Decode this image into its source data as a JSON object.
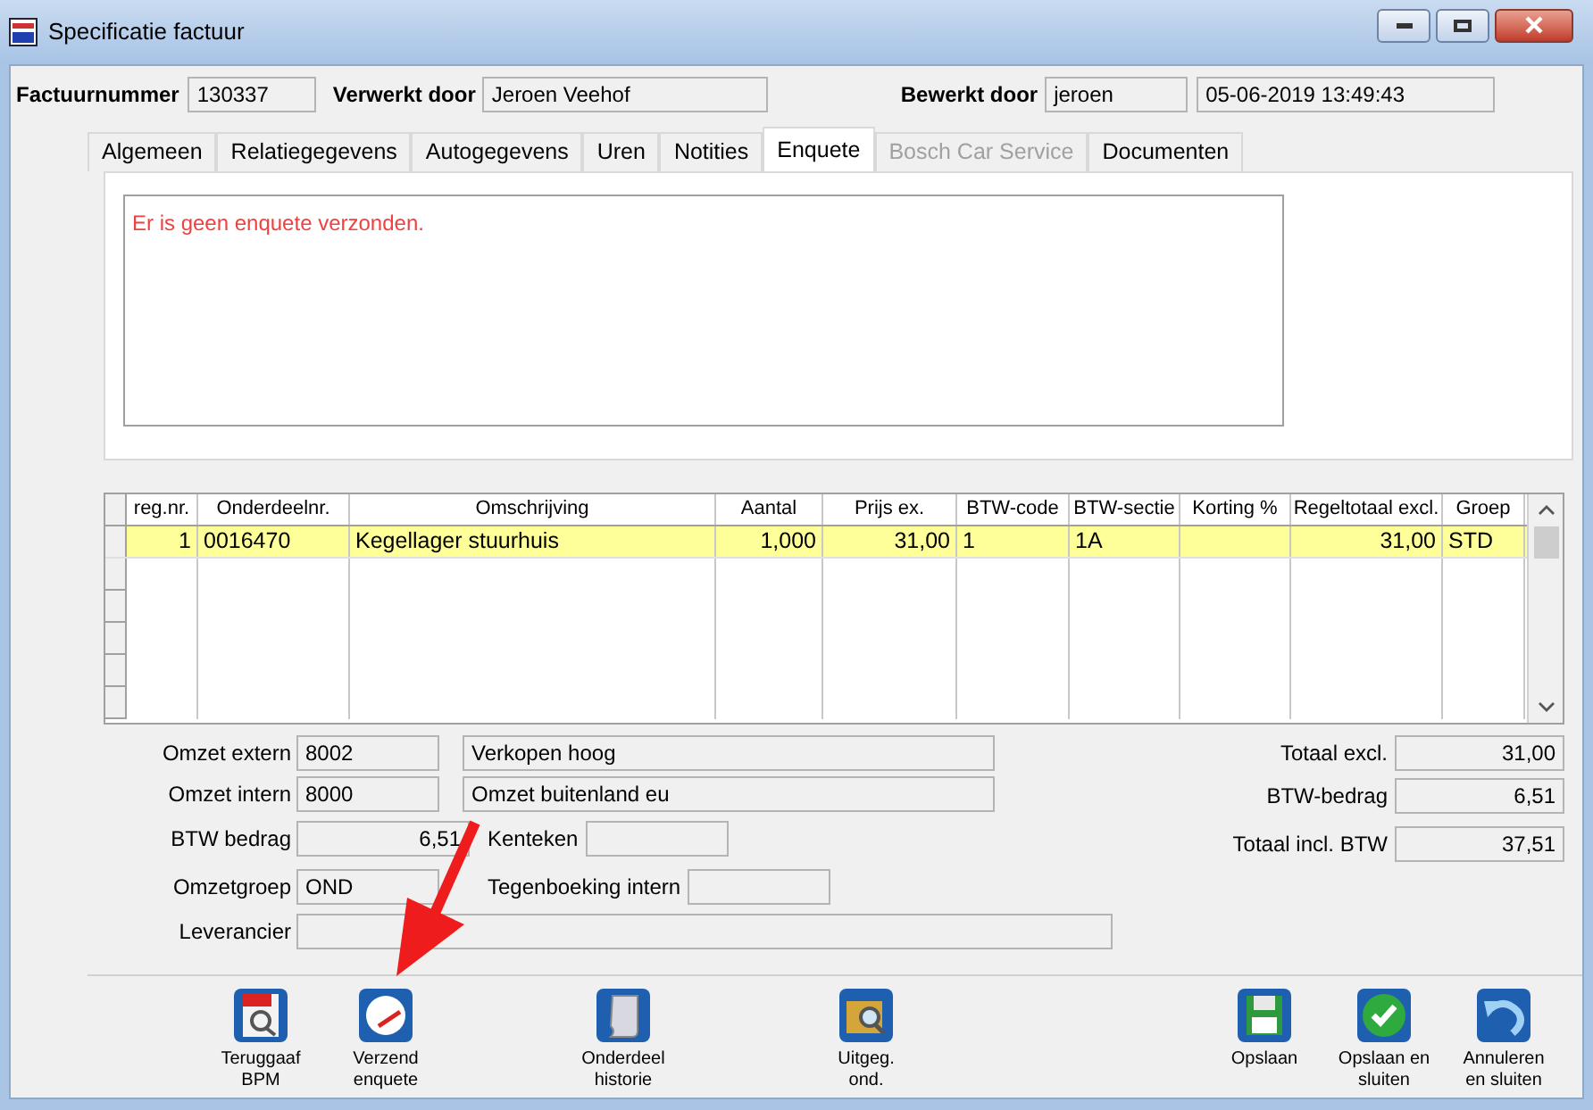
{
  "window": {
    "title": "Specificatie factuur"
  },
  "header": [
    {
      "label": "Factuurnummer",
      "value": "130337"
    },
    {
      "label": "Verwerkt door",
      "value": "Jeroen Veehof"
    },
    {
      "label": "Bewerkt door",
      "value": "jeroen"
    },
    {
      "value": "05-06-2019 13:49:43"
    }
  ],
  "tabs": [
    {
      "label": "Algemeen",
      "selected": false,
      "disabled": false
    },
    {
      "label": "Relatiegegevens",
      "selected": false,
      "disabled": false
    },
    {
      "label": "Autogegevens",
      "selected": false,
      "disabled": false
    },
    {
      "label": "Uren",
      "selected": false,
      "disabled": false
    },
    {
      "label": "Notities",
      "selected": false,
      "disabled": false
    },
    {
      "label": "Enquete",
      "selected": true,
      "disabled": false
    },
    {
      "label": "Bosch Car Service",
      "selected": false,
      "disabled": true
    },
    {
      "label": "Documenten",
      "selected": false,
      "disabled": false
    }
  ],
  "enquete": {
    "message": "Er is geen enquete verzonden."
  },
  "table": {
    "columns": [
      "reg.nr.",
      "Onderdeelnr.",
      "Omschrijving",
      "Aantal",
      "Prijs ex.",
      "BTW-code",
      "BTW-sectie",
      "Korting %",
      "Regeltotaal excl.",
      "Groep"
    ],
    "rows": [
      {
        "selected": true,
        "cells": [
          "1",
          "0016470",
          "Kegellager stuurhuis",
          "1,000",
          "31,00",
          "1",
          "1A",
          "",
          "31,00",
          "STD"
        ]
      }
    ]
  },
  "form": {
    "omzet_extern": {
      "label": "Omzet extern",
      "code": "8002",
      "description": "Verkopen hoog"
    },
    "omzet_intern": {
      "label": "Omzet intern",
      "code": "8000",
      "description": "Omzet buitenland eu"
    },
    "btw_bedrag": {
      "label": "BTW bedrag",
      "value": "6,51"
    },
    "kenteken": {
      "label": "Kenteken"
    },
    "omzetgroep": {
      "label": "Omzetgroep",
      "value": "OND"
    },
    "tegenboeking": {
      "label": "Tegenboeking intern"
    },
    "leverancier": {
      "label": "Leverancier"
    },
    "totals": [
      {
        "label": "Totaal excl.",
        "value": "31,00"
      },
      {
        "label": "BTW-bedrag",
        "value": "6,51"
      },
      {
        "label": "Totaal incl. BTW",
        "value": "37,51"
      }
    ]
  },
  "toolbar": [
    {
      "kind": "pdf",
      "label": "Teruggaaf\nBPM"
    },
    {
      "kind": "send",
      "label": "Verzend\nenquete"
    },
    {
      "kind": "scroll",
      "label": "Onderdeel\nhistorie"
    },
    {
      "kind": "box",
      "label": "Uitgeg.\nond."
    },
    {
      "kind": "save",
      "label": "Opslaan"
    },
    {
      "kind": "check",
      "label": "Opslaan en\nsluiten"
    },
    {
      "kind": "undo",
      "label": "Annuleren\nen sluiten"
    }
  ]
}
